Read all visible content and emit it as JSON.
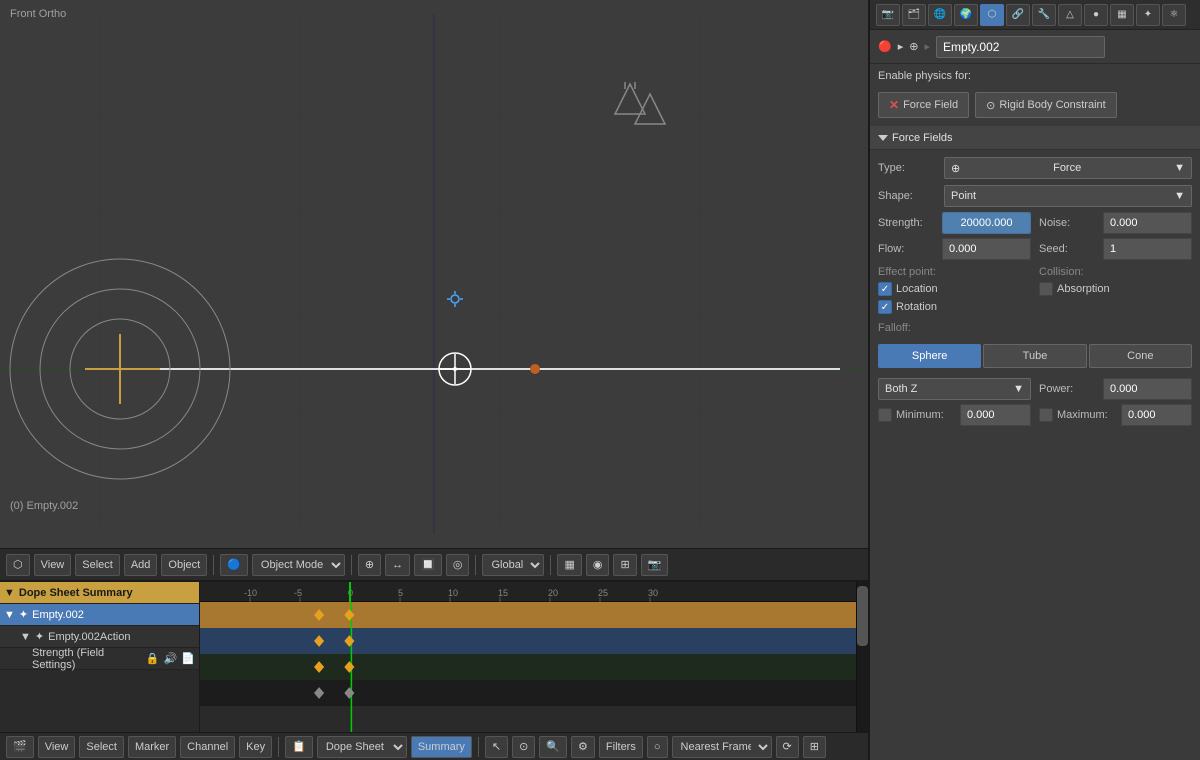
{
  "viewport": {
    "label": "Front Ortho",
    "status": "(0) Empty.002"
  },
  "viewport_toolbar": {
    "view": "View",
    "select": "Select",
    "add": "Add",
    "object": "Object",
    "mode": "Object Mode",
    "global": "Global"
  },
  "dope_sheet": {
    "rows": [
      {
        "label": "Dope Sheet Summary",
        "type": "summary"
      },
      {
        "label": "Empty.002",
        "type": "selected"
      },
      {
        "label": "Empty.002Action",
        "type": "action"
      },
      {
        "label": "Strength (Field Settings)",
        "type": "field"
      }
    ],
    "toolbar": {
      "view": "View",
      "select": "Select",
      "marker": "Marker",
      "channel": "Channel",
      "key": "Key",
      "mode": "Dope Sheet",
      "summary": "Summary",
      "snap": "Nearest Frame",
      "filters": "Filters"
    }
  },
  "properties": {
    "header_title": "Empty.002",
    "breadcrumb": "🔴",
    "enable_physics_label": "Enable physics for:",
    "force_field_btn": "Force Field",
    "rigid_body_btn": "Rigid Body Constraint",
    "force_fields_section": "Force Fields",
    "type_label": "Type:",
    "type_value": "Force",
    "shape_label": "Shape:",
    "shape_value": "Point",
    "strength_label": "Strength:",
    "strength_value": "20000.000",
    "noise_label": "Noise:",
    "noise_value": "0.000",
    "flow_label": "Flow:",
    "flow_value": "0.000",
    "seed_label": "Seed:",
    "seed_value": "1",
    "effect_point_label": "Effect point:",
    "location_label": "Location",
    "rotation_label": "Rotation",
    "collision_label": "Collision:",
    "absorption_label": "Absorption",
    "falloff_label": "Falloff:",
    "falloff_sphere": "Sphere",
    "falloff_tube": "Tube",
    "falloff_cone": "Cone",
    "both_z_label": "Both Z",
    "power_label": "Power:",
    "power_value": "0.000",
    "min_label": "Minimum:",
    "min_value": "0.000",
    "max_label": "Maximum:",
    "max_value": "0.000"
  },
  "timeline": {
    "markers": [
      "-10",
      "-5",
      "0",
      "5",
      "10",
      "15",
      "20",
      "25",
      "30"
    ],
    "current_frame": "0",
    "snap_mode": "Nearest Frame"
  }
}
